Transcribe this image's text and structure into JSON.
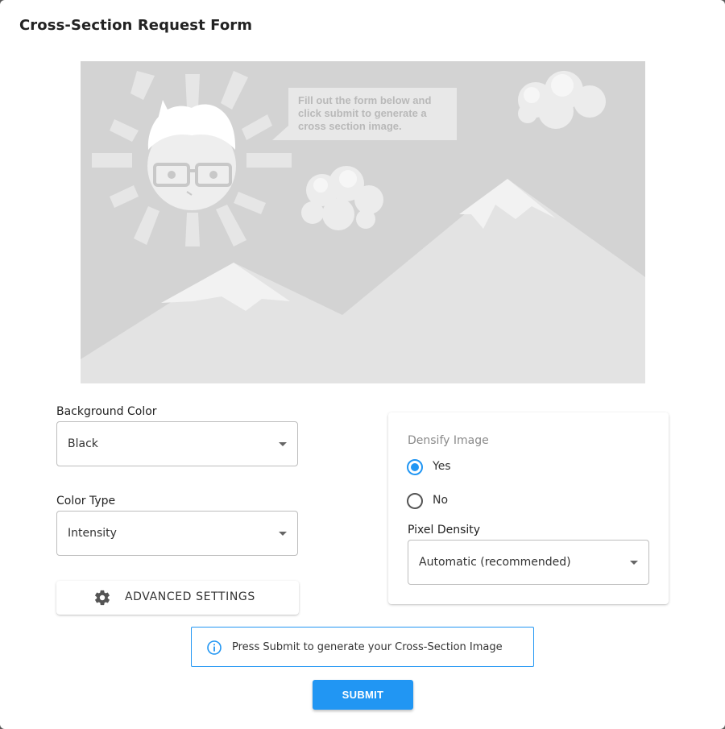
{
  "dialog": {
    "title": "Cross-Section Request Form"
  },
  "placeholder_image": {
    "callout_lines": [
      "Fill out the form below and",
      "click submit to generate a",
      "cross section image."
    ]
  },
  "form": {
    "background_color": {
      "label": "Background Color",
      "value": "Black"
    },
    "color_type": {
      "label": "Color Type",
      "value": "Intensity"
    },
    "advanced_settings": {
      "label": "ADVANCED SETTINGS",
      "icon": "gear-icon"
    }
  },
  "density_card": {
    "densify_label": "Densify Image",
    "options": [
      {
        "label": "Yes",
        "selected": true
      },
      {
        "label": "No",
        "selected": false
      }
    ],
    "pixel_density": {
      "label": "Pixel Density",
      "value": "Automatic (recommended)"
    }
  },
  "info": {
    "icon": "info-icon",
    "text": "Press Submit to generate your Cross-Section Image"
  },
  "submit": {
    "label": "SUBMIT"
  },
  "colors": {
    "accent": "#2196f3",
    "placeholder_bg": "#d3d3d3"
  }
}
